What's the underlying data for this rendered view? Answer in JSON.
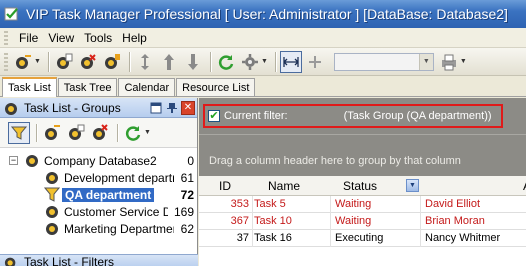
{
  "window": {
    "title": "VIP Task Manager Professional [ User: Administrator ] [DataBase: Database2]"
  },
  "menu": {
    "items": [
      "File",
      "View",
      "Tools",
      "Help"
    ]
  },
  "tabs": [
    "Task List",
    "Task Tree",
    "Calendar",
    "Resource List"
  ],
  "left_panel": {
    "header": "Task List - Groups",
    "tree": [
      {
        "label": "Company Database2",
        "count": "0"
      },
      {
        "label": "Development departr",
        "count": "61"
      },
      {
        "label": "QA department",
        "count": "72"
      },
      {
        "label": "Customer Service De",
        "count": "169"
      },
      {
        "label": "Marketing Departmer",
        "count": "62"
      }
    ],
    "bottom_header": "Task List - Filters"
  },
  "right_panel": {
    "filter_label": "Current filter:",
    "filter_value": "(Task Group  (QA department))",
    "group_hint": "Drag a column header here to group by that column",
    "columns": {
      "id": "ID",
      "name": "Name",
      "status": "Status",
      "extra": "A"
    },
    "rows": [
      {
        "id": "353",
        "name": "Task 5",
        "status": "Waiting",
        "user": "David Elliot",
        "highlight": true
      },
      {
        "id": "367",
        "name": "Task 10",
        "status": "Waiting",
        "user": "Brian Moran",
        "highlight": true
      },
      {
        "id": "37",
        "name": "Task 16",
        "status": "Executing",
        "user": "Nancy Whitmer",
        "highlight": false
      }
    ]
  },
  "colors": {
    "titlebar": "#2e63b2",
    "accent_tab": "#e6a23c",
    "filter_border": "#e01a1a",
    "selection": "#316ac5",
    "overdue_text": "#c41a1a"
  }
}
